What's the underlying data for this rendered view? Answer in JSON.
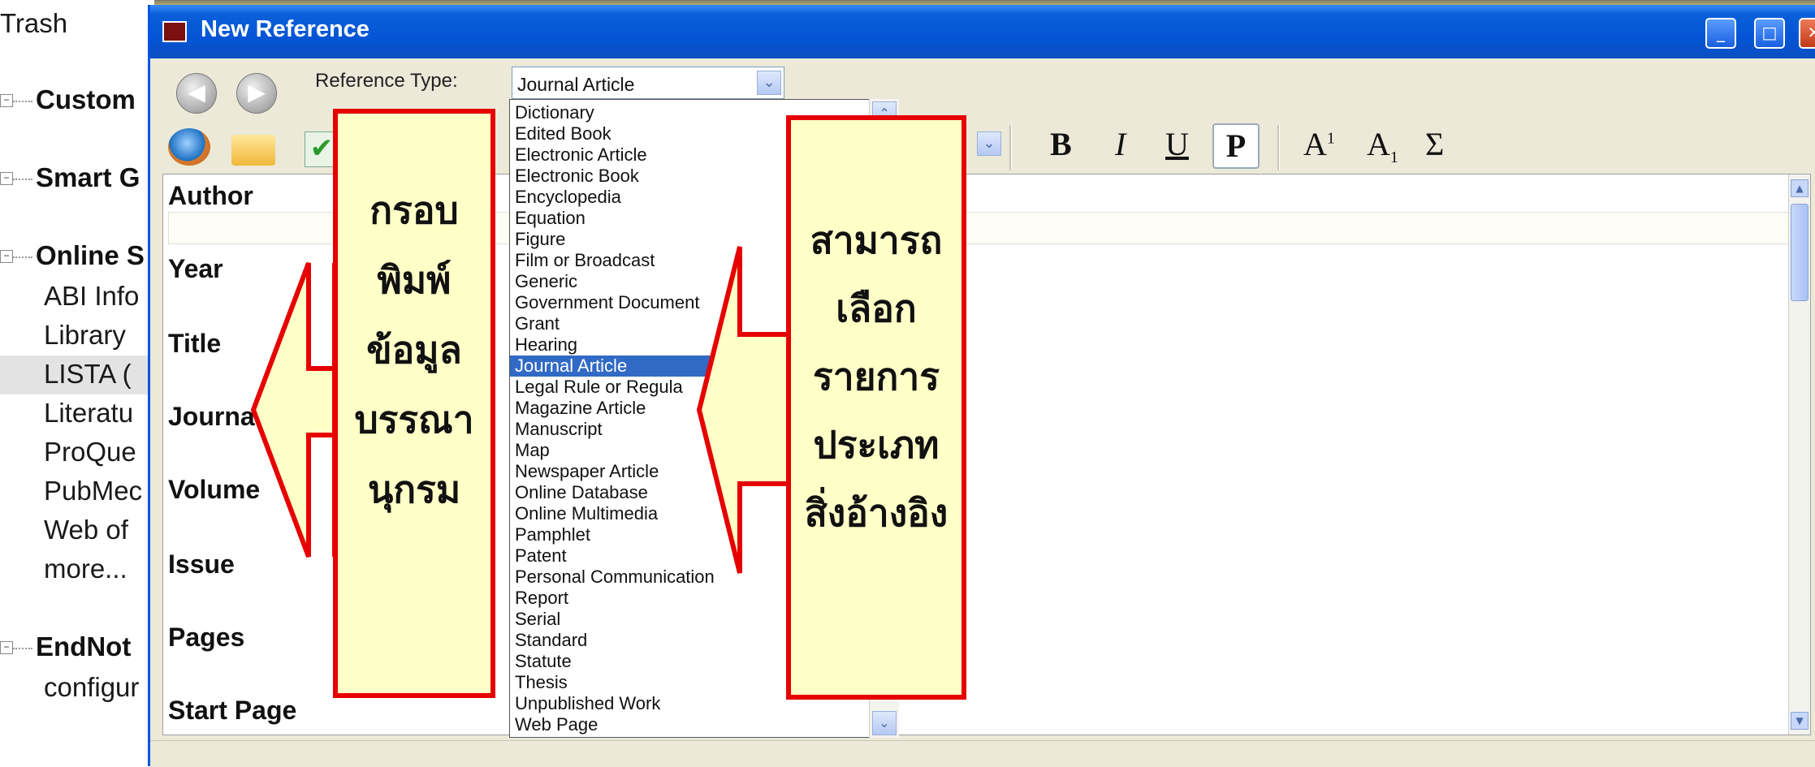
{
  "sidebar": {
    "trash": "Trash",
    "groups": [
      {
        "label": "Custom",
        "items": []
      },
      {
        "label": "Smart G",
        "items": []
      },
      {
        "label": "Online S",
        "items": [
          "ABI Info",
          "Library",
          "LISTA (",
          "Literatu",
          "ProQue",
          "PubMec",
          "Web of",
          "more..."
        ]
      },
      {
        "label": "EndNot",
        "items": [
          "configur"
        ]
      }
    ]
  },
  "dialog": {
    "title": "New Reference",
    "window_buttons": {
      "minimize": "_",
      "maximize": "□",
      "close": "✕"
    },
    "reference_type_label": "Reference Type:",
    "reference_type_value": "Journal Article",
    "format_buttons": [
      "B",
      "I",
      "U",
      "P"
    ],
    "format_superscript": "A",
    "format_superscript_mark": "1",
    "format_subscript": "A",
    "format_subscript_mark": "1",
    "format_symbol": "Σ",
    "fields": [
      "Author",
      "Year",
      "Title",
      "Journa",
      "Volume",
      "Issue",
      "Pages",
      "Start Page"
    ]
  },
  "dropdown": {
    "items": [
      "Dictionary",
      "Edited Book",
      "Electronic Article",
      "Electronic Book",
      "Encyclopedia",
      "Equation",
      "Figure",
      "Film or Broadcast",
      "Generic",
      "Government Document",
      "Grant",
      "Hearing",
      "Journal Article",
      "Legal Rule or Regula",
      "Magazine Article",
      "Manuscript",
      "Map",
      "Newspaper Article",
      "Online Database",
      "Online Multimedia",
      "Pamphlet",
      "Patent",
      "Personal Communication",
      "Report",
      "Serial",
      "Standard",
      "Statute",
      "Thesis",
      "Unpublished Work",
      "Web Page"
    ],
    "selected": "Journal Article"
  },
  "annotations": {
    "left": [
      "กรอบ",
      "พิมพ์",
      "ข้อมูล",
      "บรรณา",
      "นุกรม"
    ],
    "right": [
      "สามารถ",
      "เลือก",
      "รายการ",
      "ประเภท",
      "สิ่งอ้างอิง"
    ],
    "border_color": "#e60000",
    "fill_color": "#ffffc8"
  },
  "colors": {
    "titlebar": "#0455d6",
    "selection": "#316ac5",
    "dialog_bg": "#ece9d8"
  }
}
